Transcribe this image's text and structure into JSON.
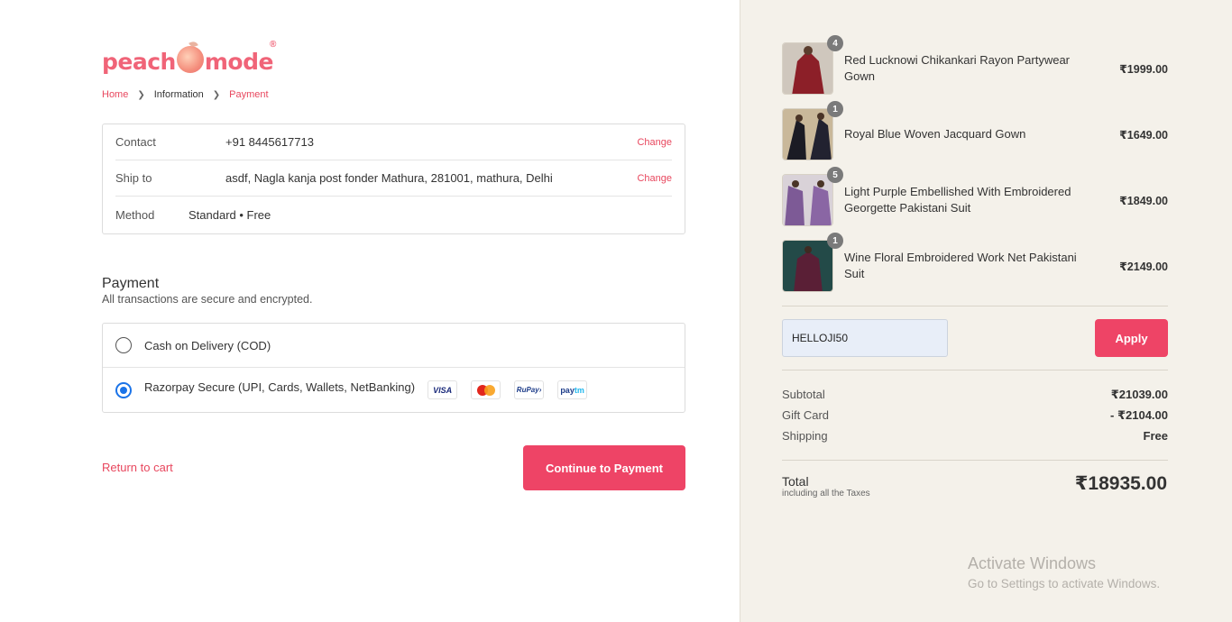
{
  "brand": {
    "logo_left": "peach",
    "logo_right": "mode",
    "registered": "®"
  },
  "breadcrumb": {
    "home": "Home",
    "information": "Information",
    "payment": "Payment"
  },
  "info": {
    "contact_label": "Contact",
    "contact_value": "+91 8445617713",
    "ship_label": "Ship to",
    "ship_value": "asdf, Nagla kanja post fonder Mathura, 281001, mathura, Delhi",
    "method_label": "Method",
    "method_value": "Standard • Free",
    "change_label": "Change"
  },
  "payment": {
    "title": "Payment",
    "subtitle": "All transactions are secure and encrypted.",
    "options": [
      {
        "label": "Cash on Delivery (COD)",
        "selected": false
      },
      {
        "label": "Razorpay Secure (UPI, Cards, Wallets, NetBanking)",
        "selected": true
      }
    ],
    "card_logos": {
      "visa": "VISA",
      "rupay": "RuPay›",
      "paytm_a": "pay",
      "paytm_b": "tm"
    }
  },
  "actions": {
    "return": "Return to cart",
    "continue": "Continue to Payment"
  },
  "cart": {
    "items": [
      {
        "name": "Red Lucknowi Chikankari Rayon Partywear Gown",
        "qty": "4",
        "price": "₹1999.00",
        "thumb_color": "#8c1f28"
      },
      {
        "name": "Royal Blue Woven Jacquard Gown",
        "qty": "1",
        "price": "₹1649.00",
        "thumb_color": "#1b1b24"
      },
      {
        "name": "Light Purple Embellished With Embroidered Georgette Pakistani Suit",
        "qty": "5",
        "price": "₹1849.00",
        "thumb_color": "#7d5a96"
      },
      {
        "name": "Wine Floral Embroidered Work Net Pakistani Suit",
        "qty": "1",
        "price": "₹2149.00",
        "thumb_color": "#5a1f36"
      }
    ],
    "discount_code": "HELLOJI50",
    "apply_label": "Apply",
    "subtotal_label": "Subtotal",
    "subtotal": "₹21039.00",
    "giftcard_label": "Gift Card",
    "giftcard": "- ₹2104.00",
    "shipping_label": "Shipping",
    "shipping": "Free",
    "total_label": "Total",
    "total_note": "including all the Taxes",
    "total": "₹18935.00"
  },
  "watermark": {
    "line1": "Activate Windows",
    "line2": "Go to Settings to activate Windows."
  },
  "colors": {
    "accent": "#ee4466",
    "sidebar_bg": "#f4f1ea",
    "radio_selected": "#1a73e8"
  }
}
